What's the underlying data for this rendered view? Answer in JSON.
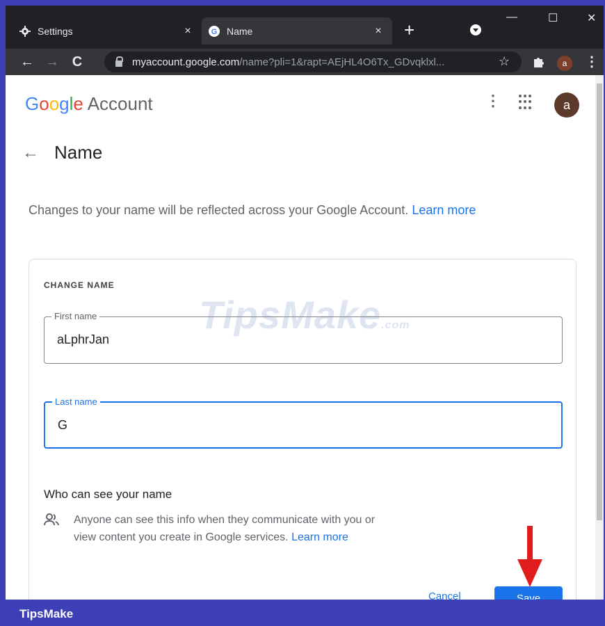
{
  "browser": {
    "tabs": [
      {
        "label": "Settings",
        "close": "×"
      },
      {
        "label": "Name",
        "close": "×"
      }
    ],
    "new_tab": "+",
    "window_controls": {
      "minimize": "—",
      "maximize": "☐",
      "close": "✕"
    },
    "url_host": "myaccount.google.com",
    "url_path": "/name?pli=1&rapt=AEjHL4O6Tx_GDvqklxl...",
    "profile_initial": "a"
  },
  "header": {
    "logo_letters": [
      "G",
      "o",
      "o",
      "g",
      "l",
      "e"
    ],
    "logo_suffix": "Account",
    "avatar_initial": "a"
  },
  "page": {
    "title": "Name",
    "description": "Changes to your name will be reflected across your Google Account.",
    "learn_more_1": "Learn more"
  },
  "card": {
    "title": "CHANGE NAME",
    "first_name": {
      "label": "First name",
      "value": "aLphrJan"
    },
    "last_name": {
      "label": "Last name",
      "value": "G"
    },
    "who_title": "Who can see your name",
    "who_desc": "Anyone can see this info when they communicate with you or view content you create in Google services.",
    "learn_more_2": "Learn more",
    "cancel_label": "Cancel",
    "save_label": "Save"
  },
  "watermark": {
    "main": "TipsMake",
    "suffix": ".com"
  },
  "footer": {
    "brand": "TipsMake"
  },
  "colors": {
    "accent": "#1a73e8",
    "arrow": "#e01c1c",
    "footer": "#3c3fb5"
  },
  "icons": [
    "settings-gear-icon",
    "google-g-icon",
    "tab-search-icon",
    "back-arrow-icon",
    "forward-arrow-icon",
    "reload-icon",
    "lock-icon",
    "star-icon",
    "extensions-puzzle-icon",
    "more-vert-icon",
    "apps-grid-icon",
    "people-icon",
    "red-arrow-icon"
  ]
}
